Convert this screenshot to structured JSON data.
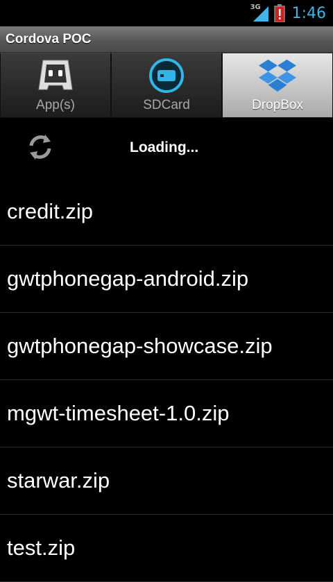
{
  "status_bar": {
    "network": "3G",
    "time": "1:46",
    "colors": {
      "time": "#3fb4e6",
      "alert": "#cc2222"
    }
  },
  "app": {
    "title": "Cordova POC"
  },
  "tabs": [
    {
      "label": "App(s)",
      "icon": "cordova-robot-icon",
      "active": false
    },
    {
      "label": "SDCard",
      "icon": "sdcard-icon",
      "active": false
    },
    {
      "label": "DropBox",
      "icon": "dropbox-icon",
      "active": true
    }
  ],
  "loading": {
    "text": "Loading...",
    "icon": "refresh-icon"
  },
  "files": [
    "credit.zip",
    "gwtphonegap-android.zip",
    "gwtphonegap-showcase.zip",
    "mgwt-timesheet-1.0.zip",
    "starwar.zip",
    "test.zip"
  ]
}
